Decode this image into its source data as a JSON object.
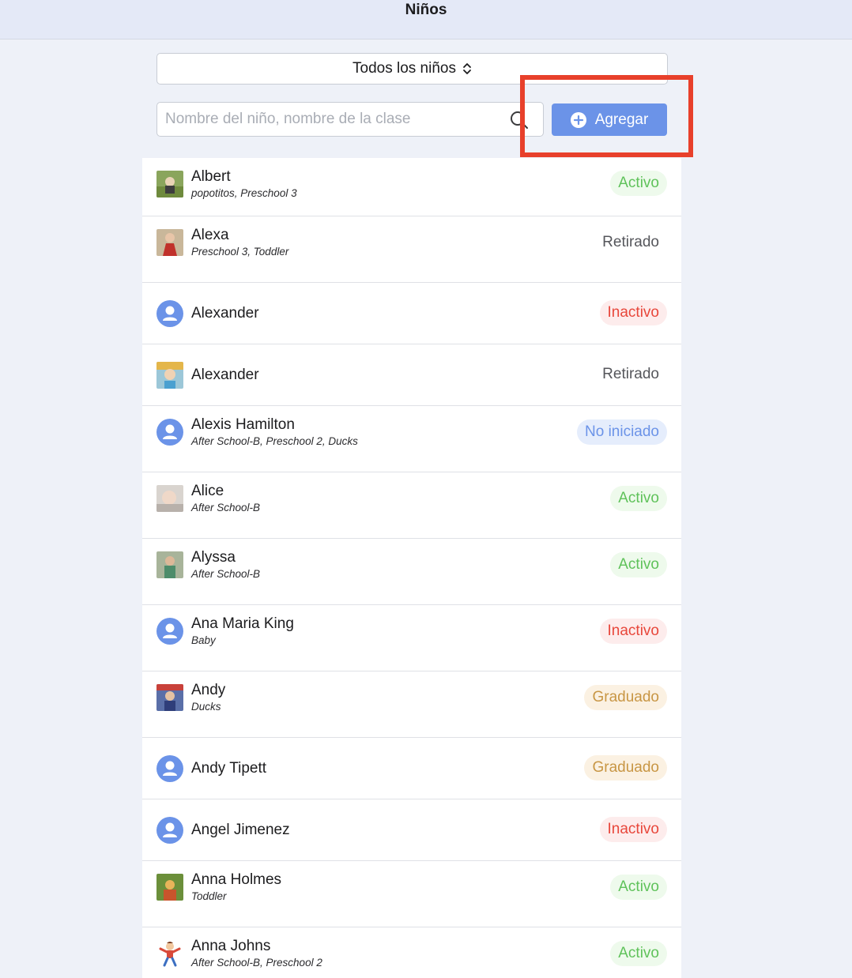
{
  "header": {
    "title": "Niños"
  },
  "filter": {
    "label": "Todos los niños"
  },
  "search": {
    "placeholder": "Nombre del niño, nombre de la clase",
    "value": ""
  },
  "add_button": {
    "label": "Agregar"
  },
  "colors": {
    "accent": "#6b93e8",
    "highlight": "#e8402b",
    "activo": "#5fc25a",
    "inactivo": "#e8473b",
    "graduado": "#c89644"
  },
  "children": [
    {
      "name": "Albert",
      "classes": "popotitos, Preschool 3",
      "status": "Activo",
      "status_key": "activo",
      "avatar": "photo"
    },
    {
      "name": "Alexa",
      "classes": "Preschool 3, Toddler",
      "status": "Retirado",
      "status_key": "retirado",
      "avatar": "photo"
    },
    {
      "name": "Alexander",
      "classes": "",
      "status": "Inactivo",
      "status_key": "inactivo",
      "avatar": "person-icon"
    },
    {
      "name": "Alexander",
      "classes": "",
      "status": "Retirado",
      "status_key": "retirado",
      "avatar": "photo"
    },
    {
      "name": "Alexis Hamilton",
      "classes": "After School-B, Preschool 2, Ducks",
      "status": "No iniciado",
      "status_key": "noiniciado",
      "avatar": "person-icon"
    },
    {
      "name": "Alice",
      "classes": "After School-B",
      "status": "Activo",
      "status_key": "activo",
      "avatar": "photo"
    },
    {
      "name": "Alyssa",
      "classes": "After School-B",
      "status": "Activo",
      "status_key": "activo",
      "avatar": "photo"
    },
    {
      "name": "Ana Maria King",
      "classes": "Baby",
      "status": "Inactivo",
      "status_key": "inactivo",
      "avatar": "person-icon"
    },
    {
      "name": "Andy",
      "classes": "Ducks",
      "status": "Graduado",
      "status_key": "graduado",
      "avatar": "photo"
    },
    {
      "name": "Andy Tipett",
      "classes": "",
      "status": "Graduado",
      "status_key": "graduado",
      "avatar": "person-icon"
    },
    {
      "name": "Angel Jimenez",
      "classes": "",
      "status": "Inactivo",
      "status_key": "inactivo",
      "avatar": "person-icon"
    },
    {
      "name": "Anna Holmes",
      "classes": "Toddler",
      "status": "Activo",
      "status_key": "activo",
      "avatar": "photo"
    },
    {
      "name": "Anna Johns",
      "classes": "After School-B, Preschool 2",
      "status": "Activo",
      "status_key": "activo",
      "avatar": "cartoon"
    }
  ]
}
